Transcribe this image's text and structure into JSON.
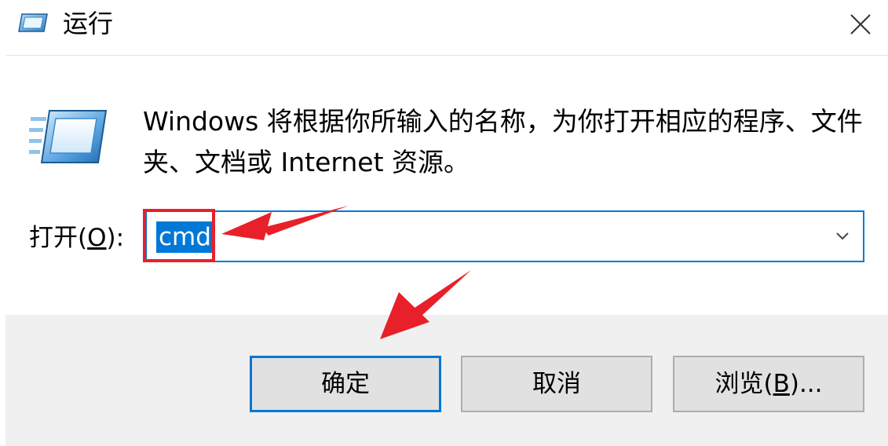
{
  "window": {
    "title": "运行",
    "icon": "run-icon",
    "close_icon": "close-icon"
  },
  "description": "Windows 将根据你所输入的名称，为你打开相应的程序、文件夹、文档或 Internet 资源。",
  "open": {
    "label_prefix": "打开(",
    "label_accel": "O",
    "label_suffix": "):",
    "value": "cmd"
  },
  "buttons": {
    "ok": "确定",
    "cancel": "取消",
    "browse_prefix": "浏览(",
    "browse_accel": "B",
    "browse_suffix": ")..."
  },
  "colors": {
    "accent": "#0078d7",
    "annotation": "#e8202a",
    "buttonbar": "#f0f0f0"
  }
}
